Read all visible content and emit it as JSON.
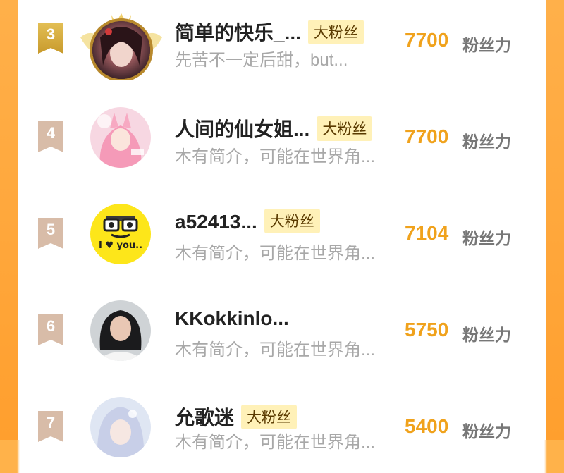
{
  "badge_label": "大粉丝",
  "score_unit": "粉丝力",
  "rows": [
    {
      "rank": "3",
      "name": "简单的快乐_...",
      "has_badge": true,
      "bio": "先苦不一定后甜，but...",
      "score": "7700"
    },
    {
      "rank": "4",
      "name": "人间的仙女姐...",
      "has_badge": true,
      "bio": "木有简介，可能在世界角...",
      "score": "7700"
    },
    {
      "rank": "5",
      "name": "a52413...",
      "has_badge": true,
      "bio": "木有简介，可能在世界角...",
      "score": "7104"
    },
    {
      "rank": "6",
      "name": "KKokkinlo...",
      "has_badge": false,
      "bio": "木有简介，可能在世界角...",
      "score": "5750"
    },
    {
      "rank": "7",
      "name": "允歌迷",
      "has_badge": true,
      "bio": "木有简介，可能在世界角...",
      "score": "5400"
    }
  ],
  "avatar5_text": "I ♥ you.."
}
